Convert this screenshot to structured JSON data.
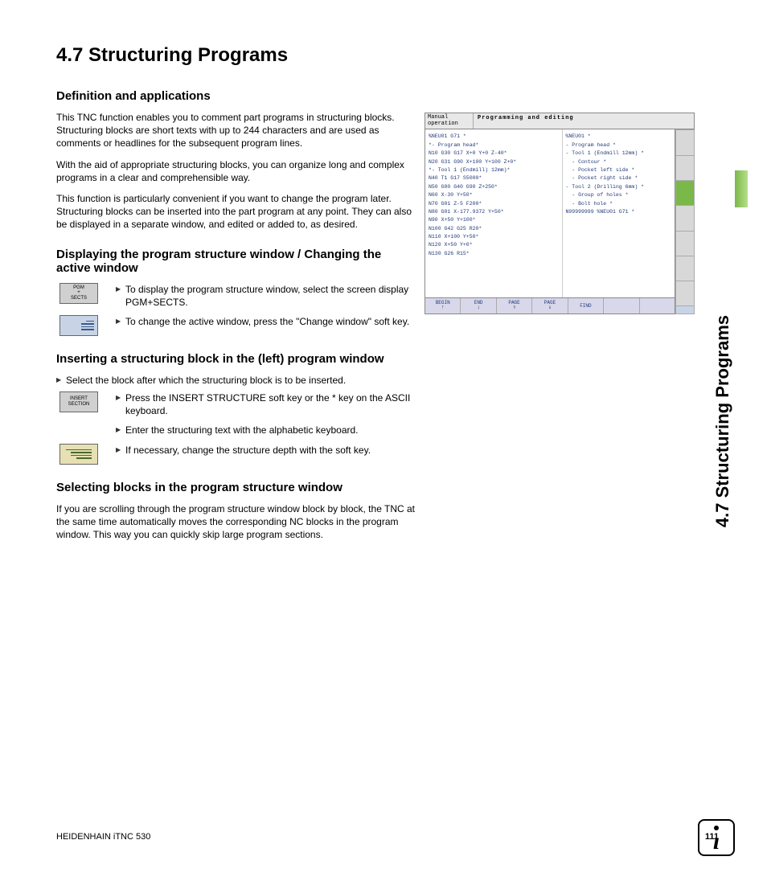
{
  "page": {
    "main_title": "4.7  Structuring Programs",
    "side_tab": "4.7 Structuring Programs",
    "footer_left": "HEIDENHAIN iTNC 530",
    "page_number": "111"
  },
  "s1": {
    "head": "Definition and applications",
    "p1": "This TNC function enables you to comment part programs in structuring blocks. Structuring blocks are short texts with up to 244 characters and are used as comments or headlines for the subsequent program lines.",
    "p2": "With the aid of appropriate structuring blocks, you can organize long and complex programs in a clear and comprehensible way.",
    "p3": "This function is particularly convenient if you want to change the program later. Structuring blocks can be inserted into the part program at any point. They can also be displayed in a separate window, and edited or added to, as desired."
  },
  "s2": {
    "head": "Displaying the program structure window / Changing the active window",
    "key1_l1": "PGM",
    "key1_l2": "+",
    "key1_l3": "SECTS",
    "step1": "To display the program structure window, select the screen display PGM+SECTS.",
    "step2": "To change the active window, press the \"Change window\" soft key."
  },
  "s3": {
    "head": "Inserting a structuring block in the (left) program window",
    "step0": "Select the block after which the structuring block is to be inserted.",
    "key1_l1": "INSERT",
    "key1_l2": "SECTION",
    "step1": "Press the INSERT STRUCTURE soft key or the * key on the ASCII keyboard.",
    "step2": "Enter the structuring text with the alphabetic keyboard.",
    "step3": "If necessary, change the structure depth with the soft key."
  },
  "s4": {
    "head": "Selecting blocks in the program structure window",
    "p1": "If you are scrolling through the program structure window block by block, the TNC at the same time automatically moves the corresponding NC blocks in the program window. This way you can quickly skip large program sections."
  },
  "fig": {
    "mode": "Manual operation",
    "title": "Programming and editing",
    "left_lines": [
      "%NEU01 G71 *",
      "*- Program head*",
      "N10 G30 G17 X+0 Y+0 Z-40*",
      "N20 G31 G90 X+100 Y+100 Z+0*",
      "*- Tool 1 (Endmill) 12mm)*",
      "N40 T1 G17 S5000*",
      "N50 G00 G40 G90 Z+250*",
      "N60 X-30 Y+50*",
      "N70 G01 Z-5 F200*",
      "N80 G01 X-177.9372 Y+50*",
      "N90 X+50 Y+100*",
      "N100 G42 G25 R20*",
      "N110 X+100 Y+50*",
      "N120 X+50 Y+0*",
      "N130 G26 R15*"
    ],
    "right_lines": [
      "%NEU01 *",
      "- Program head *",
      "- Tool 1 (Endmill 12mm) *",
      "  - Contour *",
      "  - Pocket left side *",
      "  - Pocket right side *",
      "- Tool 2 (Drilling 6mm) *",
      "  - Group of holes *",
      "  - Bolt hole *",
      "N99999999 %NEU01 G71 *"
    ],
    "sk": [
      "BEGIN",
      "END",
      "PAGE",
      "PAGE",
      "FIND",
      "",
      ""
    ],
    "sk_arrows": [
      "↑",
      "↓",
      "⇑",
      "⇓",
      "",
      "",
      ""
    ]
  }
}
